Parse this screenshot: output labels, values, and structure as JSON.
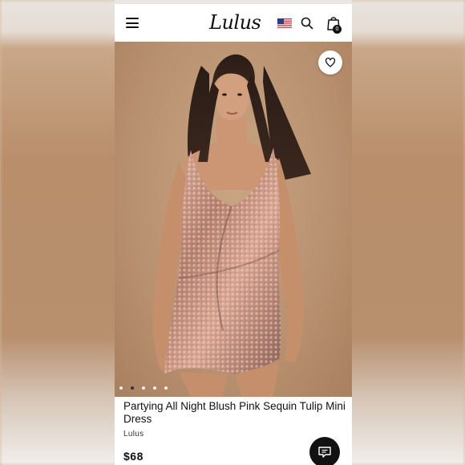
{
  "header": {
    "logo_text": "Lulus",
    "menu_icon": "hamburger-menu-icon",
    "flag_icon": "us-flag-icon",
    "search_icon": "search-icon",
    "bag_icon": "shopping-bag-icon",
    "bag_count": "0"
  },
  "gallery": {
    "favorite_icon": "heart-outline-icon",
    "image_count": 5,
    "active_index": 1
  },
  "product": {
    "title": "Partying All Night Blush Pink Sequin Tulip Mini Dress",
    "brand": "Lulus",
    "price": "$68"
  },
  "chat": {
    "icon": "chat-bubble-icon"
  },
  "colors": {
    "header_bg": "#ffffff",
    "text": "#111111",
    "dress": "#c8927f",
    "backdrop": "#b8906e"
  }
}
